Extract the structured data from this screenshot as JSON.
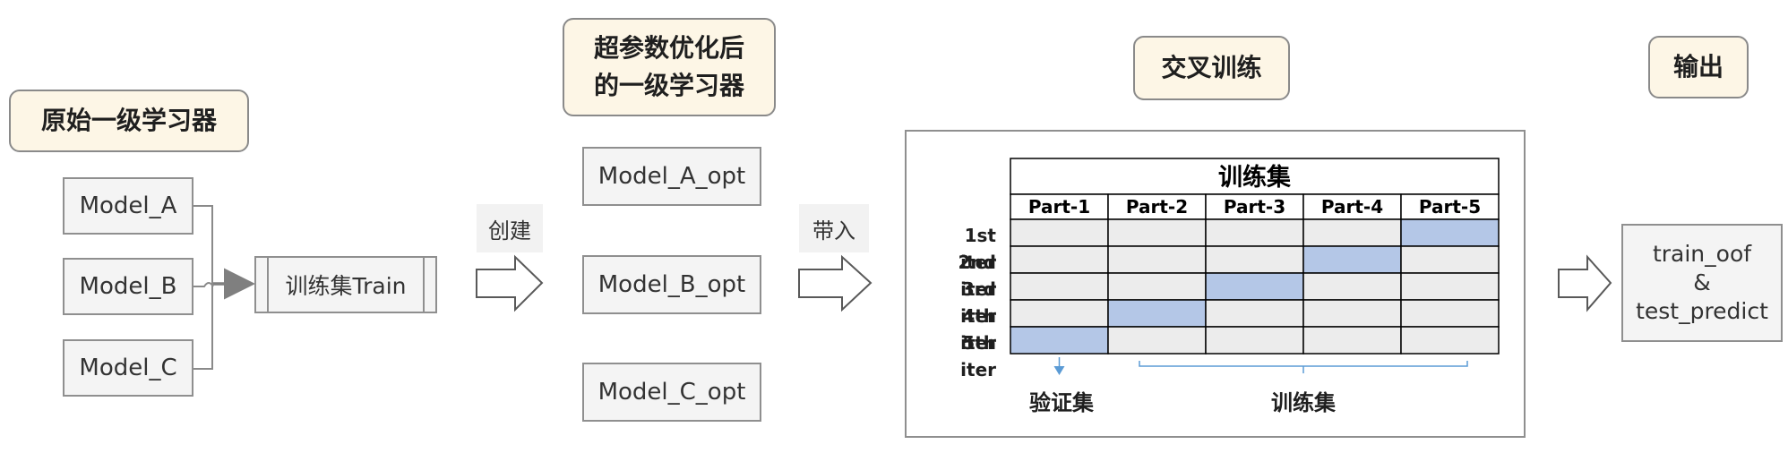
{
  "headers": {
    "base": "原始一级学习器",
    "opt_line1": "超参数优化后",
    "opt_line2": "的一级学习器",
    "cv": "交叉训练",
    "output": "输出"
  },
  "base_models": [
    "Model_A",
    "Model_B",
    "Model_C"
  ],
  "train_box": "训练集Train",
  "create_label": "创建",
  "bring_label": "带入",
  "opt_models": [
    "Model_A_opt",
    "Model_B_opt",
    "Model_C_opt"
  ],
  "grid": {
    "title": "训练集",
    "parts": [
      "Part-1",
      "Part-2",
      "Part-3",
      "Part-4",
      "Part-5"
    ],
    "iters": [
      "1st iter",
      "2nd iter",
      "3rd iter",
      "4th iter",
      "5th iter"
    ],
    "validation_part_index": [
      4,
      3,
      2,
      1,
      0
    ],
    "cell_color": "#ececec",
    "highlight_color": "#b4c7e7"
  },
  "bottom_labels": {
    "validation": "验证集",
    "train": "训练集"
  },
  "output_box": {
    "line1": "train_oof",
    "line2": "&",
    "line3": "test_predict"
  },
  "colors": {
    "cream": "#fdf6e6",
    "box_bg": "#f4f4f4",
    "border": "#8f8f8f",
    "bracket": "#5b9bd5"
  }
}
